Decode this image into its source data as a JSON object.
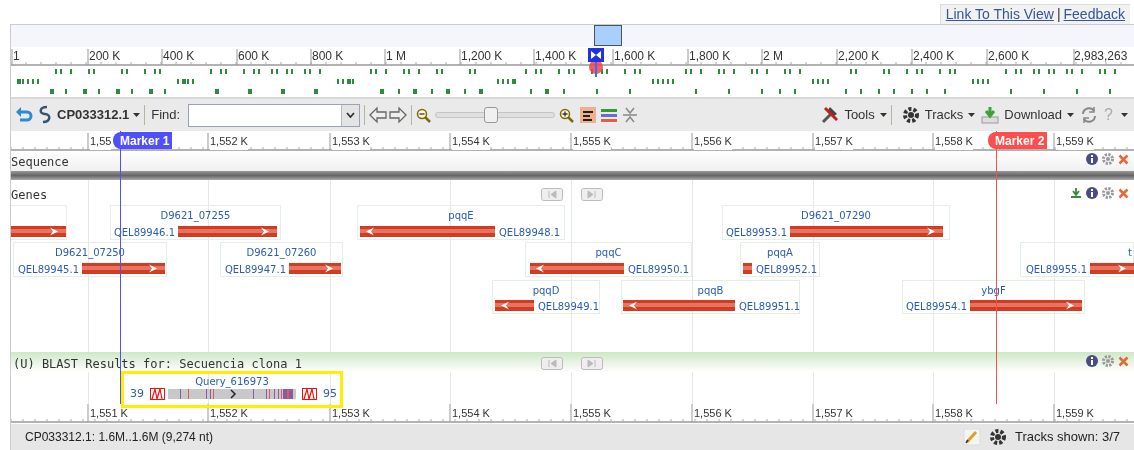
{
  "header_links": [
    {
      "label": "Link To This View"
    },
    {
      "label": "Feedback"
    }
  ],
  "header_link_separator": "|",
  "overview": {
    "ruler_labels": [
      "1",
      "200 K",
      "400 K",
      "600 K",
      "800 K",
      "1 M",
      "1,200 K",
      "1,400 K",
      "1,600 K",
      "1,800 K",
      "2 M",
      "2,200 K",
      "2,400 K",
      "2,600 K",
      "2,983,263"
    ]
  },
  "toolbar": {
    "sequence": "CP033312.1",
    "find_label": "Find:",
    "zoom_slider": {
      "level": 0.47
    },
    "menus": [
      {
        "label": "Tools",
        "kind": "tools"
      },
      {
        "label": "Tracks",
        "kind": "tracks"
      },
      {
        "label": "Download",
        "kind": "download"
      }
    ],
    "help": "?"
  },
  "markers": [
    {
      "label": "Marker 1",
      "color": "#4f4fff"
    },
    {
      "label": "Marker 2",
      "color": "#ff4d4d"
    }
  ],
  "ruler_labels": [
    "1,55",
    "1,552 K",
    "1,553 K",
    "1,554 K",
    "1,555 K",
    "1,556 K",
    "1,557 K",
    "1,558 K",
    "1,559 K"
  ],
  "tracks": [
    {
      "kind": "sequence",
      "title": "Sequence"
    },
    {
      "kind": "genes",
      "title": "Genes",
      "genes": [
        {
          "reverse": false
        },
        {
          "name": "D9621_07255",
          "protein": "QEL89946.1",
          "reverse": false
        },
        {
          "name": "pqqE",
          "protein": "QEL89948.1",
          "reverse": true
        },
        {
          "name": "D9621_07290",
          "protein": "QEL89953.1",
          "reverse": false
        },
        {
          "name": "D9621_07250",
          "protein": "QEL89945.1",
          "reverse": false
        },
        {
          "name": "D9621_07260",
          "protein": "QEL89947.1",
          "reverse": false
        },
        {
          "name": "pqqC",
          "protein": "QEL89950.1",
          "reverse": true
        },
        {
          "name": "pqqA",
          "protein": "QEL89952.1"
        },
        {
          "name": "t",
          "protein": "QEL89955.1",
          "reverse": false
        },
        {
          "name": "pqqD",
          "protein": "QEL89949.1",
          "reverse": true
        },
        {
          "name": "pqqB",
          "protein": "QEL89951.1",
          "reverse": true
        },
        {
          "name": "ybgF",
          "protein": "QEL89954.1",
          "reverse": false
        }
      ]
    },
    {
      "kind": "blast",
      "title": "(U) BLAST Results for: Secuencia clona 1",
      "hit": {
        "label": "Query_616973",
        "start": "39",
        "end": "95",
        "highlighted": true
      }
    }
  ],
  "bottom_ruler_labels": [
    "1,551 K",
    "1,552 K",
    "1,553 K",
    "1,554 K",
    "1,555 K",
    "1,556 K",
    "1,557 K",
    "1,558 K",
    "1,559 K"
  ],
  "status": {
    "text": "CP033312.1: 1.6M..1.6M (9,274 nt)",
    "tracks_shown": "Tracks shown: 3/7"
  }
}
